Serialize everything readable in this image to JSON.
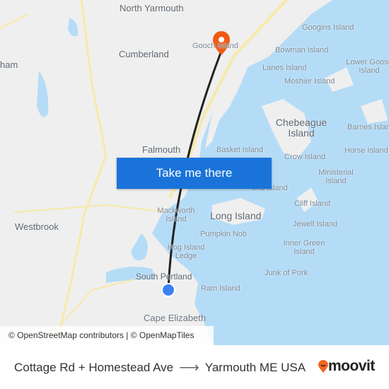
{
  "map": {
    "labels": {
      "north_yarmouth": "North Yarmouth",
      "cumberland": "Cumberland",
      "gooch_island": "Gooch Island",
      "googins_island": "Googins Island",
      "bowman_island": "Bowman Island",
      "lanes_island": "Lanes Island",
      "lower_goose_island": "Lower Goose Island",
      "moshier_island": "Moshier Island",
      "chebeague_island": "Chebeague Island",
      "barnes_island": "Barnes Island",
      "horse_island": "Horse Island",
      "crow_island": "Crow Island",
      "ministerial_island": "Ministerial Island",
      "basket_island": "Basket Island",
      "falmouth": "Falmouth",
      "cliff_island": "Cliff Island",
      "jewell_island": "Jewell Island",
      "long_island": "Long Island",
      "mackworth_island": "Mackworth Island",
      "pumpkin_nob": "Pumpkin Nob",
      "hog_island_ledge": "Hog Island Ledge",
      "inner_green_island": "Inner Green Island",
      "junk_of_pork": "Junk of Pork",
      "westbrook": "Westbrook",
      "south_portland": "South Portland",
      "ram_island": "Ram Island",
      "cape_elizabeth": "Cape Elizabeth",
      "gorham_partial": "ham",
      "great_diamond_partial": "ond Island"
    },
    "origin_marker_color": "#3b82f0",
    "destination_marker_color": "#f05a14",
    "route_color": "#222222",
    "cta_label": "Take me there",
    "attribution": "© OpenStreetMap contributors | © OpenMapTiles"
  },
  "footer": {
    "origin": "Cottage Rd + Homestead Ave",
    "arrow_icon": "arrow-right-icon",
    "destination": "Yarmouth ME USA",
    "brand": "moovit",
    "brand_color": "#f26522"
  }
}
